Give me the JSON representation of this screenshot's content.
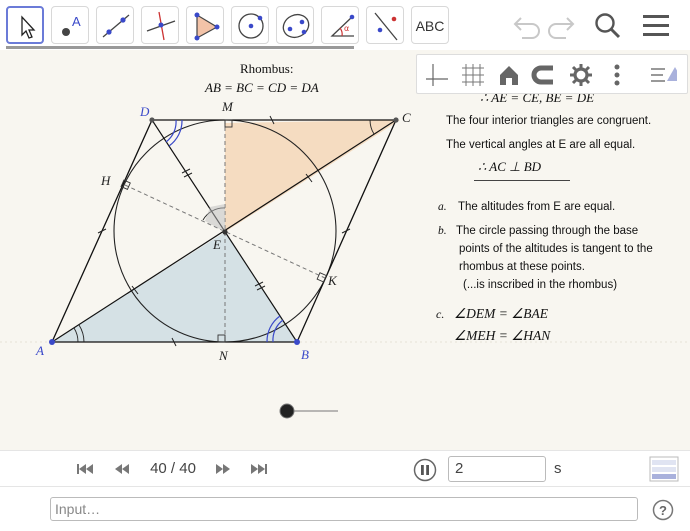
{
  "toolbar": {
    "tools": [
      "move-tool",
      "point-tool",
      "line-tool",
      "perpendicular-line-tool",
      "polygon-tool",
      "circle-tool",
      "conic-tool",
      "angle-tool",
      "reflect-tool",
      "text-tool"
    ],
    "text_tool_label": "ABC"
  },
  "style_bar": {
    "buttons": [
      "axes",
      "grid",
      "home",
      "magnet",
      "settings",
      "more",
      "hide"
    ]
  },
  "figure": {
    "title": "Rhombus:",
    "equation": "AB = BC = CD = DA",
    "points": {
      "A": "A",
      "B": "B",
      "C": "C",
      "D": "D",
      "E": "E",
      "M": "M",
      "N": "N",
      "H": "H",
      "K": "K"
    }
  },
  "notes": {
    "line_top": "∴ AE = CE,   BE = DE",
    "line1": "The four interior triangles are congruent.",
    "line2": "The vertical angles at E are all equal.",
    "conclusion": "∴ AC ⊥ BD",
    "a_label": "a.",
    "a_text": "The altitudes from E are equal.",
    "b_label": "b.",
    "b_text1": "The circle passing through the base",
    "b_text2": "points of  the altitudes is tangent to the",
    "b_text3": "rhombus at  these points.",
    "b_text4": "(...is inscribed in the rhombus)",
    "c_label": "c.",
    "c_text1": "∠DEM = ∠BAE",
    "c_text2": "∠MEH = ∠HAN"
  },
  "player": {
    "frame": "40 / 40",
    "speed": "2",
    "unit": "s"
  },
  "input": {
    "placeholder": "Input…"
  },
  "colors": {
    "accent": "#6b7bd8",
    "orange_fill": "#f5d7b8",
    "blue_fill": "#cfdde3",
    "point_blue": "#3a49c9"
  }
}
